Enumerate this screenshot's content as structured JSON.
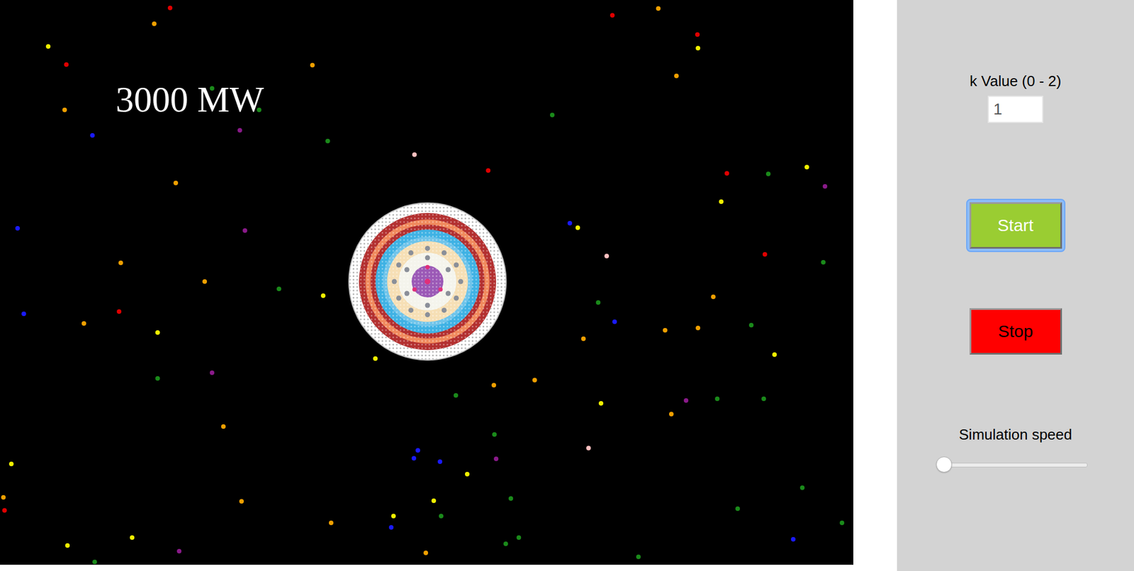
{
  "power": {
    "text": "3000 MW"
  },
  "k_value": {
    "label": "k Value (0 - 2)",
    "value": "1"
  },
  "buttons": [
    {
      "label": "Start",
      "kind": "start",
      "focused": true
    },
    {
      "label": "Stop",
      "kind": "stop",
      "focused": false
    }
  ],
  "speed": {
    "label": "Simulation speed",
    "level": 0
  },
  "particles": [
    {
      "color": "#e00000"
    },
    {
      "color": "#f0a000"
    },
    {
      "color": "#f0f000"
    },
    {
      "color": "#e00000"
    },
    {
      "color": "#f0a000"
    },
    {
      "color": "#1a8a1a"
    },
    {
      "color": "#1a8a1a"
    },
    {
      "color": "#1a1aff"
    },
    {
      "color": "#8a1a8a"
    },
    {
      "color": "#f0a000"
    },
    {
      "color": "#1a8a1a"
    },
    {
      "color": "#f0a000"
    },
    {
      "color": "#1a1aff"
    },
    {
      "color": "#8a1a8a"
    },
    {
      "color": "#f0a000"
    },
    {
      "color": "#f0a000"
    },
    {
      "color": "#1a8a1a"
    },
    {
      "color": "#f0f000"
    },
    {
      "color": "#1a1aff"
    },
    {
      "color": "#f0a000"
    },
    {
      "color": "#e00000"
    },
    {
      "color": "#f0f000"
    },
    {
      "color": "#1a8a1a"
    },
    {
      "color": "#8a1a8a"
    },
    {
      "color": "#f0f000"
    },
    {
      "color": "#f0a000"
    },
    {
      "color": "#f0f000"
    },
    {
      "color": "#f0a000"
    },
    {
      "color": "#e00000"
    },
    {
      "color": "#f0a000"
    },
    {
      "color": "#f0f000"
    },
    {
      "color": "#f0f000"
    },
    {
      "color": "#8a1a8a"
    },
    {
      "color": "#1a8a1a"
    },
    {
      "color": "#f0a000"
    },
    {
      "color": "#f0f000"
    },
    {
      "color": "#1a1aff"
    },
    {
      "color": "#f0a000"
    },
    {
      "color": "#ffc0c0"
    },
    {
      "color": "#e00000"
    },
    {
      "color": "#1a8a1a"
    },
    {
      "color": "#e00000"
    },
    {
      "color": "#f0a000"
    },
    {
      "color": "#e00000"
    },
    {
      "color": "#f0f000"
    },
    {
      "color": "#f0a000"
    },
    {
      "color": "#e00000"
    },
    {
      "color": "#1a8a1a"
    },
    {
      "color": "#f0f000"
    },
    {
      "color": "#8a1a8a"
    },
    {
      "color": "#f0f000"
    },
    {
      "color": "#1a1aff"
    },
    {
      "color": "#f0f000"
    },
    {
      "color": "#ffc0c0"
    },
    {
      "color": "#e00000"
    },
    {
      "color": "#1a8a1a"
    },
    {
      "color": "#f0a000"
    },
    {
      "color": "#1a8a1a"
    },
    {
      "color": "#1a1aff"
    },
    {
      "color": "#f0a000"
    },
    {
      "color": "#f0a000"
    },
    {
      "color": "#1a8a1a"
    },
    {
      "color": "#f0a000"
    },
    {
      "color": "#f0f000"
    },
    {
      "color": "#f0a000"
    },
    {
      "color": "#f0a000"
    },
    {
      "color": "#1a8a1a"
    },
    {
      "color": "#f0f000"
    },
    {
      "color": "#8a1a8a"
    },
    {
      "color": "#f0a000"
    },
    {
      "color": "#1a8a1a"
    },
    {
      "color": "#1a8a1a"
    },
    {
      "color": "#1a1aff"
    },
    {
      "color": "#1a1aff"
    },
    {
      "color": "#1a1aff"
    },
    {
      "color": "#1a8a1a"
    },
    {
      "color": "#8a1a8a"
    },
    {
      "color": "#f0f000"
    },
    {
      "color": "#f0f000"
    },
    {
      "color": "#1a8a1a"
    },
    {
      "color": "#1a8a1a"
    },
    {
      "color": "#1a8a1a"
    },
    {
      "color": "#1a8a1a"
    },
    {
      "color": "#ffc0c0"
    },
    {
      "color": "#1a8a1a"
    },
    {
      "color": "#1a8a1a"
    },
    {
      "color": "#1a1aff"
    },
    {
      "color": "#1a8a1a"
    },
    {
      "color": "#1a8a1a"
    }
  ]
}
